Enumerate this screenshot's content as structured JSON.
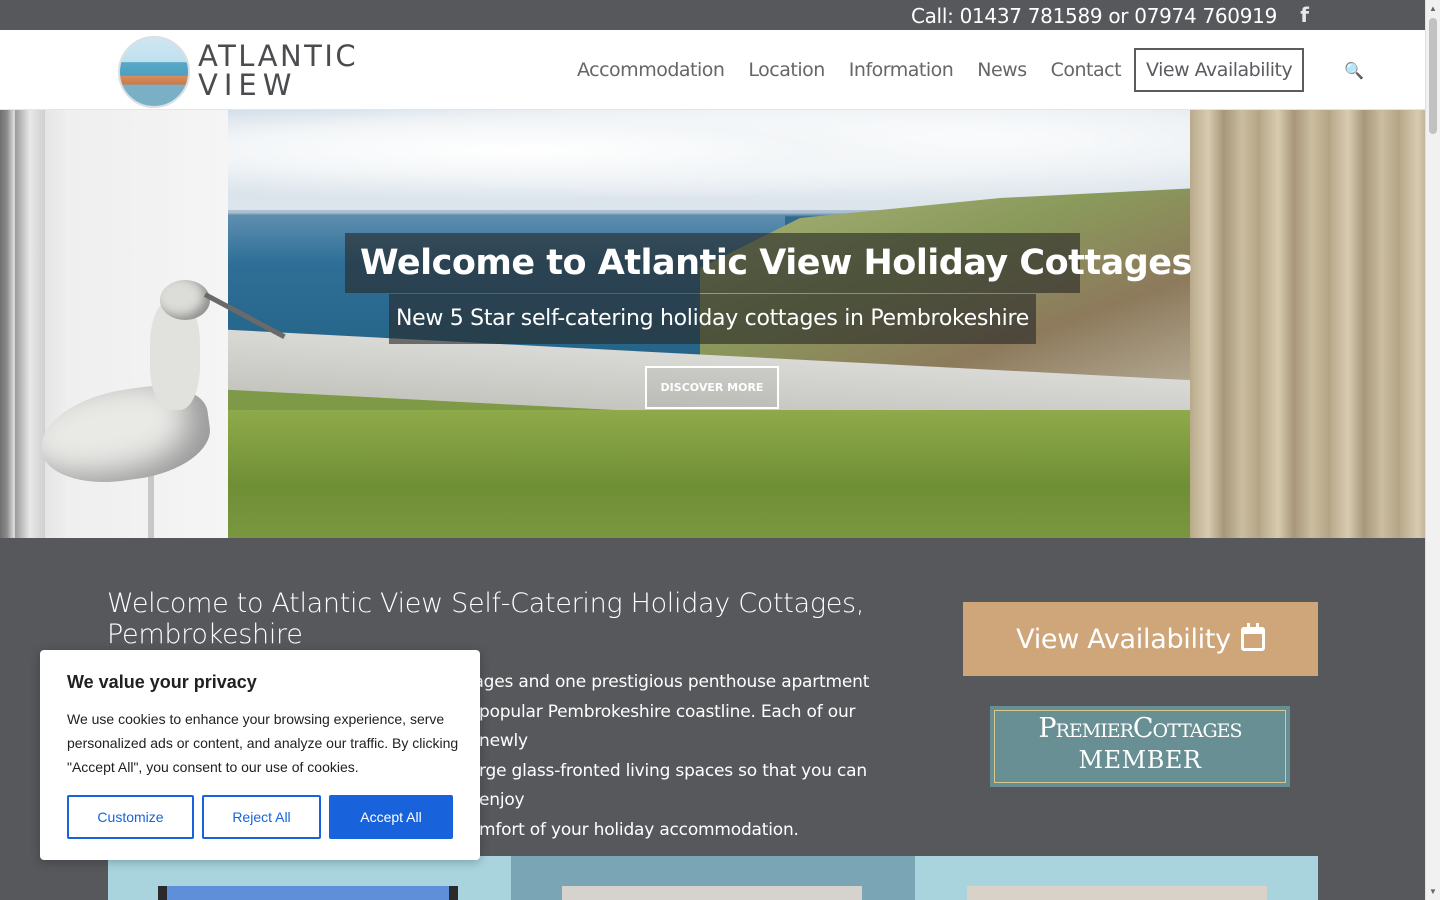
{
  "topbar": {
    "call": "Call: 01437 781589 or 07974 760919",
    "facebook_icon": "facebook-icon",
    "facebook_glyph": "f"
  },
  "logo": {
    "line1": "ATLANTIC",
    "line2": "VIEW"
  },
  "nav": {
    "items": [
      "Accommodation",
      "Location",
      "Information",
      "News",
      "Contact"
    ],
    "cta": "View Availability",
    "search_icon": "search-icon",
    "search_glyph": "🔍"
  },
  "hero": {
    "title": "Welcome to Atlantic View Holiday Cottages",
    "subtitle": "New 5 Star self-catering holiday cottages in Pembrokeshire",
    "button": "DISCOVER MORE"
  },
  "intro": {
    "title": "Welcome to Atlantic View Self-Catering Holiday Cottages, Pembrokeshire",
    "lines": [
      "tages and one prestigious penthouse apartment",
      " popular Pembrokeshire coastline. Each of our newly",
      "rge glass-fronted living spaces so that you can enjoy",
      "mfort of your holiday accommodation."
    ]
  },
  "sidebar": {
    "cta": "View Availability",
    "cta_icon": "calendar-icon",
    "premier_line1": "PremierCottages",
    "premier_line2": "MEMBER"
  },
  "cookie": {
    "title": "We value your privacy",
    "text": "We use cookies to enhance your browsing experience, serve personalized ads or content, and analyze our traffic. By clicking \"Accept All\", you consent to our use of cookies.",
    "customize": "Customize",
    "reject": "Reject All",
    "accept": "Accept All"
  },
  "colors": {
    "topbar": "#56585c",
    "accent_cta": "#cfa57a",
    "cookie_blue": "#1863dc",
    "premier_teal": "#688f93"
  }
}
